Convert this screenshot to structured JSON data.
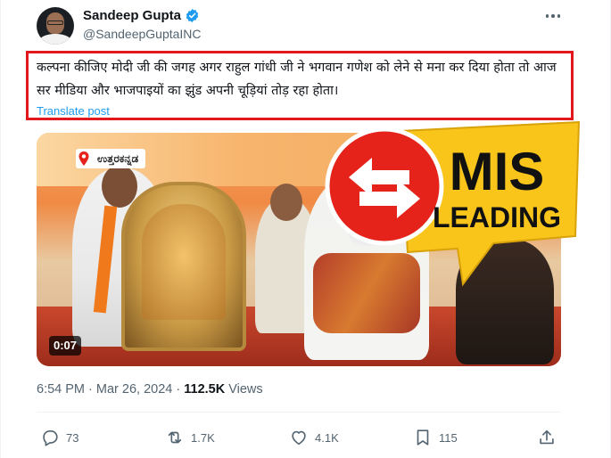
{
  "tweet": {
    "author": {
      "display_name": "Sandeep Gupta",
      "handle": "@SandeepGuptaINC",
      "verified": true
    },
    "text": "कल्पना कीजिए मोदी जी की जगह अगर राहुल गांधी जी ने भगवान गणेश को लेने से मना कर दिया होता तो आज सर मीडिया और भाजपाइयों का झुंड अपनी चूड़ियां तोड़ रहा होता।",
    "translate_label": "Translate post",
    "media": {
      "location_tag": "ಉತ್ತರಕನ್ನಡ",
      "duration": "0:07"
    },
    "time": "6:54 PM",
    "date": "Mar 26, 2024",
    "views_count": "112.5K",
    "views_label": "Views",
    "stats": {
      "replies": "73",
      "reposts": "1.7K",
      "likes": "4.1K",
      "bookmarks": "115"
    }
  },
  "overlay": {
    "stamp_line1": "MIS",
    "stamp_line2": "LEADING"
  },
  "colors": {
    "highlight_border": "#e3181f",
    "stamp_yellow": "#f9c51b",
    "stamp_red": "#e5231b",
    "link_blue": "#1d9bf0",
    "muted": "#536471"
  },
  "icons": {
    "verified": "verified-badge-icon",
    "more": "more-dots-icon",
    "reply": "reply-icon",
    "repost": "repost-icon",
    "like": "heart-icon",
    "bookmark": "bookmark-icon",
    "share": "share-icon",
    "location": "location-pin-icon",
    "misleading_arrows": "swap-arrows-icon"
  }
}
